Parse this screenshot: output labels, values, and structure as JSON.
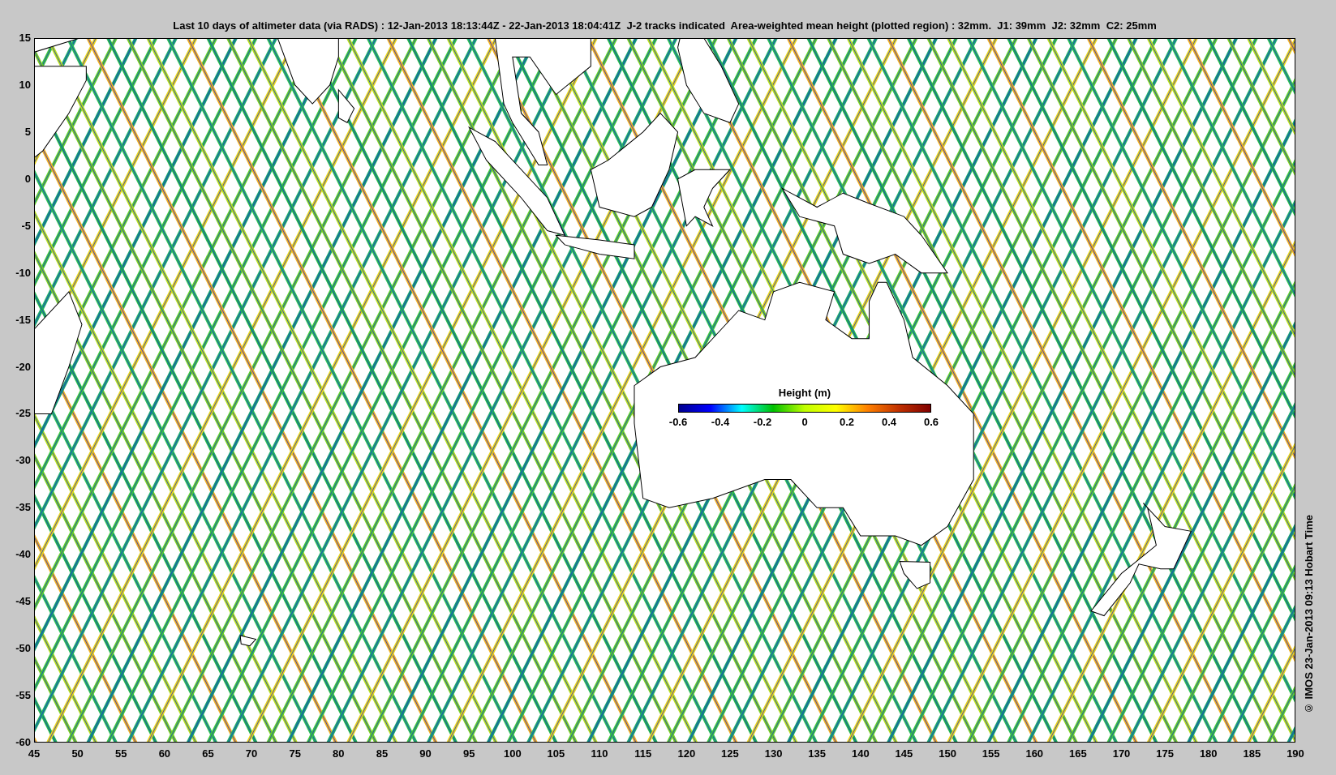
{
  "title": "Last 10 days of altimeter data (via RADS) : 12-Jan-2013 18:13:44Z - 22-Jan-2013 18:04:41Z  J-2 tracks indicated  Area-weighted mean height (plotted region) : 32mm.  J1: 39mm  J2: 32mm  C2: 25mm",
  "map": {
    "x_tick_labels": [
      "45",
      "50",
      "55",
      "60",
      "65",
      "70",
      "75",
      "80",
      "85",
      "90",
      "95",
      "100",
      "105",
      "110",
      "115",
      "120",
      "125",
      "130",
      "135",
      "140",
      "145",
      "150",
      "155",
      "160",
      "165",
      "170",
      "175",
      "180",
      "185",
      "190"
    ],
    "y_tick_labels": [
      "15",
      "10",
      "5",
      "0",
      "-5",
      "-10",
      "-15",
      "-20",
      "-25",
      "-30",
      "-35",
      "-40",
      "-45",
      "-50",
      "-55",
      "-60"
    ],
    "colorbar": {
      "title": "Height (m)",
      "tick_labels": [
        "-0.6",
        "-0.4",
        "-0.2",
        "0",
        "0.2",
        "0.4",
        "0.6"
      ]
    }
  },
  "credit": "© IMOS 23-Jan-2013 09:13 Hobart Time"
}
